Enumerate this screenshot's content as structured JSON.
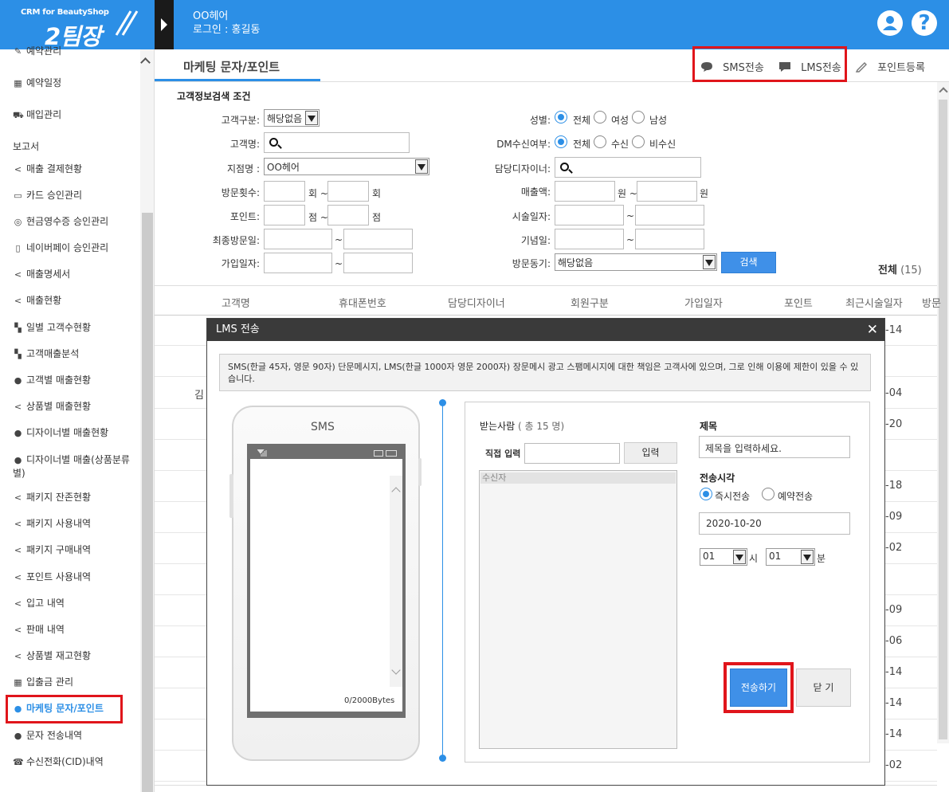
{
  "header": {
    "logo_top": "CRM for BeautyShop",
    "logo_main": "2팀장",
    "shop_name": "OO헤어",
    "login_text": "로그인 : 홍길동",
    "help_glyph": "?"
  },
  "sidebar": {
    "items": [
      {
        "icon": "edit-icon",
        "glyph": "✎",
        "label": "예약관리"
      },
      {
        "icon": "calendar-icon",
        "glyph": "▦",
        "label": "예약일정"
      },
      {
        "icon": "cart-icon",
        "glyph": "⛟",
        "label": "매입관리"
      },
      {
        "icon": "",
        "glyph": "",
        "label": "보고서"
      },
      {
        "icon": "share-icon",
        "glyph": "<",
        "label": "매출 결제현황"
      },
      {
        "icon": "card-icon",
        "glyph": "▭",
        "label": "카드 승인관리"
      },
      {
        "icon": "receipt-icon",
        "glyph": "◎",
        "label": "현금영수증 승인관리"
      },
      {
        "icon": "mobile-icon",
        "glyph": "▯",
        "label": "네이버페이 승인관리"
      },
      {
        "icon": "share-icon",
        "glyph": "<",
        "label": "매출명세서"
      },
      {
        "icon": "share-icon",
        "glyph": "<",
        "label": "매출현황"
      },
      {
        "icon": "chart-icon",
        "glyph": "▚",
        "label": "일별 고객수현황"
      },
      {
        "icon": "chart-icon",
        "glyph": "▚",
        "label": "고객매출분석"
      },
      {
        "icon": "user-icon",
        "glyph": "●",
        "label": "고객별 매출현황"
      },
      {
        "icon": "share-icon",
        "glyph": "<",
        "label": "상품별 매출현황"
      },
      {
        "icon": "user-icon",
        "glyph": "●",
        "label": "디자이너별 매출현황"
      },
      {
        "icon": "user-icon",
        "glyph": "●",
        "label": "디자이너별 매출(상품분류",
        "label2": "별)"
      },
      {
        "icon": "share-icon",
        "glyph": "<",
        "label": "패키지 잔존현황"
      },
      {
        "icon": "share-icon",
        "glyph": "<",
        "label": "패키지 사용내역"
      },
      {
        "icon": "share-icon",
        "glyph": "<",
        "label": "패키지 구매내역"
      },
      {
        "icon": "share-icon",
        "glyph": "<",
        "label": "포인트 사용내역"
      },
      {
        "icon": "share-icon",
        "glyph": "<",
        "label": "입고 내역"
      },
      {
        "icon": "share-icon",
        "glyph": "<",
        "label": "판매 내역"
      },
      {
        "icon": "share-icon",
        "glyph": "<",
        "label": "상품별 재고현황"
      },
      {
        "icon": "calc-icon",
        "glyph": "▦",
        "label": "입출금 관리"
      },
      {
        "icon": "chat-icon",
        "glyph": "●",
        "label": "마케팅 문자/포인트"
      },
      {
        "icon": "chat-icon",
        "glyph": "●",
        "label": "문자 전송내역"
      },
      {
        "icon": "phone-icon",
        "glyph": "☎",
        "label": "수신전화(CID)내역"
      }
    ]
  },
  "page": {
    "title": "마케팅 문자/포인트",
    "toolbar": {
      "sms": "SMS전송",
      "lms": "LMS전송",
      "point": "포인트등록"
    }
  },
  "search": {
    "title": "고객정보검색 조건",
    "customer_type_label": "고객구분:",
    "customer_type_value": "해당없음",
    "name_label": "고객명:",
    "branch_label": "지점명 :",
    "branch_value": "OO헤어",
    "visits_label": "방문횟수:",
    "visits_unit": "회 ~",
    "visits_unit2": "회",
    "points_label": "포인트:",
    "points_unit": "점 ~",
    "points_unit2": "점",
    "last_visit_label": "최종방문일:",
    "join_label": "가입일자:",
    "range_sep": "~",
    "gender_label": "성별:",
    "gender_options": [
      "전체",
      "여성",
      "남성"
    ],
    "dm_label": "DM수신여부:",
    "dm_options": [
      "전체",
      "수신",
      "비수신"
    ],
    "designer_label": "담당디자이너:",
    "sales_label": "매출액:",
    "sales_unit": "원 ~",
    "sales_unit2": "원",
    "treat_label": "시술일자:",
    "anniv_label": "기념일:",
    "motive_label": "방문동기:",
    "motive_value": "해당없음",
    "search_button": "검색",
    "total_label": "전체",
    "total_count": "(15)"
  },
  "grid": {
    "columns": [
      "고객명",
      "휴대폰번호",
      "담당디자이너",
      "회원구분",
      "가입일자",
      "포인트",
      "최근시술일자",
      "방문"
    ],
    "first_name": "김",
    "row_dates": [
      "-14",
      "",
      "-04",
      "-20",
      "",
      "-18",
      "-09",
      "-02",
      "",
      "-09",
      "-06",
      "-14",
      "-14",
      "-14",
      "-02"
    ]
  },
  "modal": {
    "title": "LMS 전송",
    "close": "✕",
    "notice": "SMS(한글 45자, 영문 90자) 단문메시지, LMS(한글 1000자 영문 2000자) 장문메시 광고 스팸메시지에 대한 책임은 고객사에 있으며, 그로 인해 이용에 제한이 있을 수 있습니다.",
    "phone_label": "SMS",
    "bytes": "0/2000Bytes",
    "recipients_label": "받는사람",
    "recipients_count": "( 총 15 명)",
    "direct_label": "직접 입력",
    "enter_button": "입력",
    "recipient_header": "수신자",
    "subject_label": "제목",
    "subject_value": "제목을 입력하세요.",
    "send_time_label": "전송시각",
    "send_options": [
      "즉시전송",
      "예약전송"
    ],
    "date_value": "2020-10-20",
    "hour_value": "01",
    "hour_unit": "시",
    "minute_value": "01",
    "minute_unit": "분",
    "send_button": "전송하기",
    "close_button": "닫 기"
  },
  "colors": {
    "accent": "#2c8fe6",
    "highlight": "#e0151b"
  }
}
